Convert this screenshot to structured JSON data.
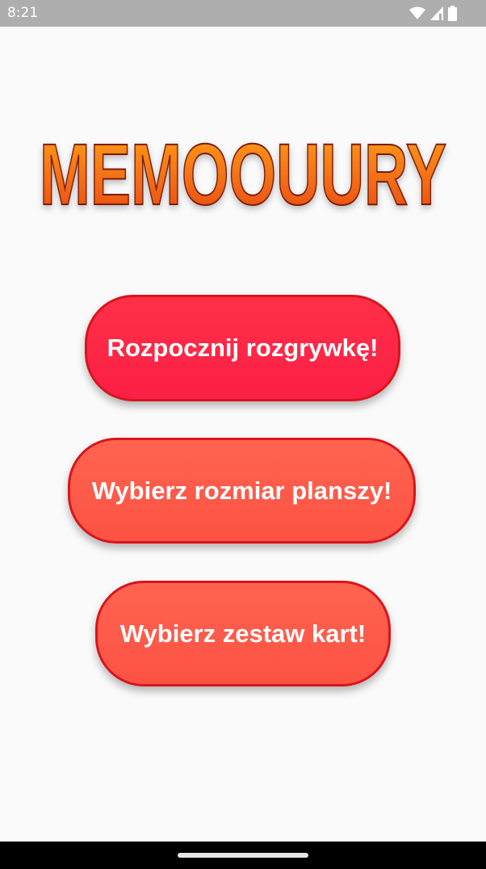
{
  "status_bar": {
    "time": "8:21",
    "icons": [
      "wifi-icon",
      "cellular-signal-icon",
      "battery-icon"
    ]
  },
  "app": {
    "title": "MEMOOUURY",
    "title_colors": {
      "top": "#ffa21a",
      "bottom": "#e8450f",
      "outline": "#7a1c0a"
    },
    "buttons": {
      "start_label": "Rozpocznij rozgrywkę!",
      "board_size_label": "Wybierz rozmiar planszy!",
      "card_set_label": "Wybierz zestaw kart!"
    },
    "colors": {
      "start_button": "#fb2547",
      "secondary_button": "#fd5a4a",
      "button_border": "#d8151c",
      "background": "#fafafa"
    }
  },
  "navigation_bar": {
    "icons": [
      "home-pill-icon"
    ]
  }
}
